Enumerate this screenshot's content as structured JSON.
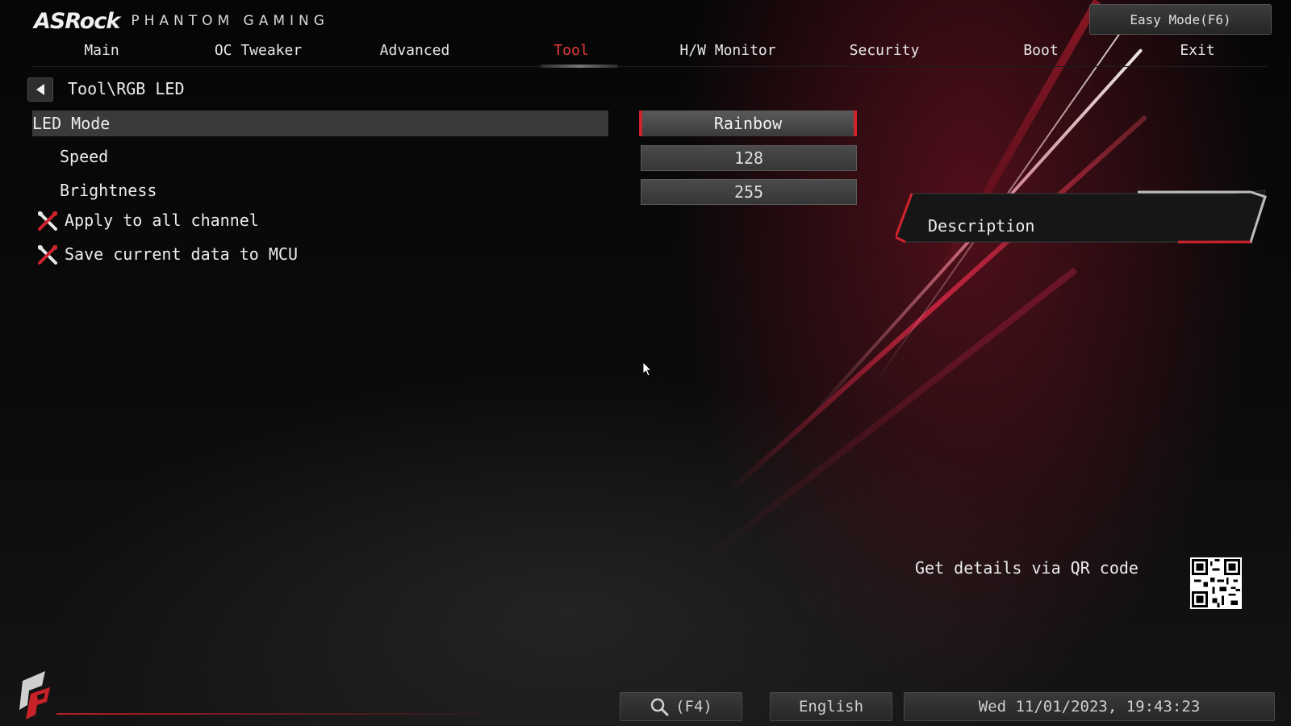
{
  "brand": {
    "logo": "ASRock",
    "subtitle": "PHANTOM GAMING"
  },
  "header": {
    "easy_mode_label": "Easy Mode(F6)"
  },
  "tabs": [
    {
      "label": "Main"
    },
    {
      "label": "OC Tweaker"
    },
    {
      "label": "Advanced"
    },
    {
      "label": "Tool",
      "active": true
    },
    {
      "label": "H/W Monitor"
    },
    {
      "label": "Security"
    },
    {
      "label": "Boot"
    },
    {
      "label": "Exit"
    }
  ],
  "breadcrumb": "Tool\\RGB LED",
  "settings": {
    "led_mode": {
      "label": "LED Mode",
      "value": "Rainbow"
    },
    "speed": {
      "label": "Speed",
      "value": "128"
    },
    "brightness": {
      "label": "Brightness",
      "value": "255"
    },
    "apply_all": {
      "label": "Apply to all channel"
    },
    "save_mcu": {
      "label": "Save current data to MCU"
    }
  },
  "description": {
    "title": "Description"
  },
  "qr": {
    "text": "Get details via QR code"
  },
  "footer": {
    "search_label": "(F4)",
    "language": "English",
    "datetime": "Wed 11/01/2023, 19:43:23"
  },
  "colors": {
    "accent_red": "#d0242c",
    "active_tab": "#e63a3a",
    "selected_row": "#3a3a3a"
  },
  "icons": {
    "back": "chevron-left-icon",
    "tool": "tool-cross-icon",
    "search": "search-icon",
    "qr": "qr-code-icon"
  }
}
